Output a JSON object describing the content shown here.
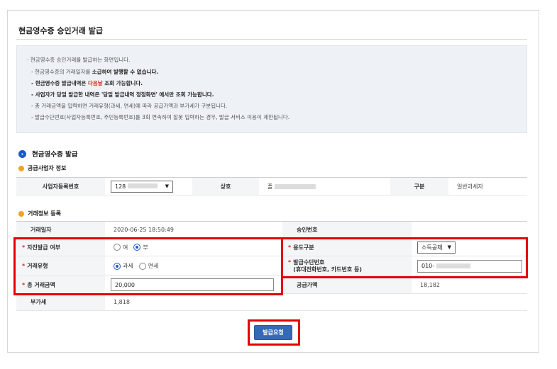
{
  "page_title": "현금영수증 승인거래 발급",
  "notice": {
    "lead": "· 현금영수증 승인거래를 발급하는 화면입니다.",
    "line1_a": "- 현금영수증의 거래일자를 ",
    "line1_b": "소급하여 발행할 수 없습니다.",
    "line2_a": "- 현금영수증 발급내역은 ",
    "line2_red": "다음날",
    "line2_b": " 조회 가능합니다.",
    "line3": "- 사업자가 당일 발급한 내역은 '당일 발급내역 정정화면' 에서만 조회 가능합니다.",
    "line4": "- 총 거래금액을 입력하면 거래유형(과세, 면세)에 따라 공급가액과 부가세가 구분됩니다.",
    "line5": "- 발급수단번호(사업자등록번호, 주민등록번호)를 3회 연속하여 잘못 입력하는 경우, 발급 서비스 이용이 제한됩니다."
  },
  "section_title": "현금영수증 발급",
  "supplier": {
    "title": "공급사업자 정보",
    "biz_no_label": "사업자등록번호",
    "biz_no_value": "128",
    "name_label": "상호",
    "name_value": "플",
    "type_label": "구분",
    "type_value": "일반과세자"
  },
  "transaction": {
    "title": "거래정보 등록",
    "date_label": "거래일자",
    "date_value": "2020-06-25 18:50:49",
    "approval_label": "승인번호",
    "approval_value": "",
    "self_issue_label": "자진발급 여부",
    "self_issue_options": [
      "여",
      "부"
    ],
    "self_issue_selected": "부",
    "purpose_label": "용도구분",
    "purpose_value": "소득공제",
    "type_label": "거래유형",
    "type_options": [
      "과세",
      "면세"
    ],
    "type_selected": "과세",
    "means_label_1": "발급수단번호",
    "means_label_2": "(휴대전화번호, 카드번호 등)",
    "means_value": "010-",
    "total_label": "총 거래금액",
    "total_value": "20,000",
    "supply_label": "공급가액",
    "supply_value": "18,182",
    "vat_label": "부가세",
    "vat_value": "1,818"
  },
  "required_mark": "*",
  "submit_label": "발급요청",
  "colors": {
    "accent": "#1a5bc4",
    "button": "#3569b8",
    "highlight": "#e30000",
    "required": "#e1261c"
  }
}
